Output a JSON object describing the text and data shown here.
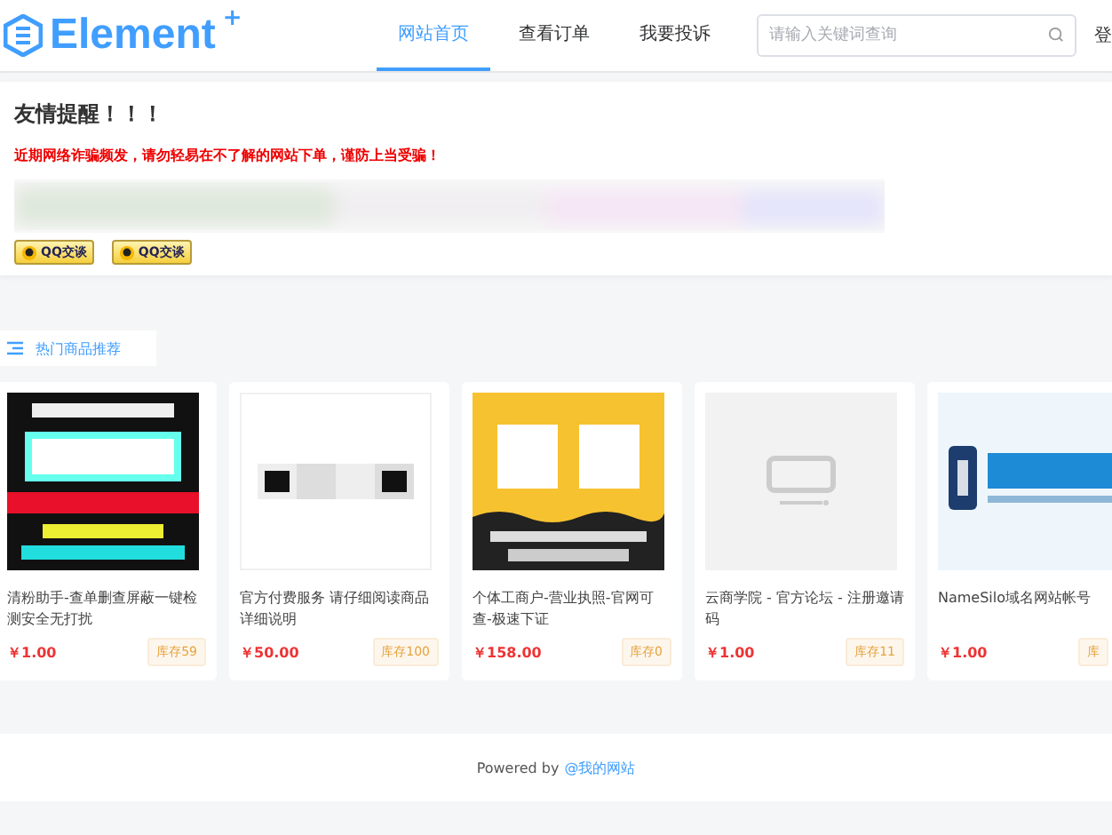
{
  "header": {
    "logo": "Element",
    "logo_mark": "+",
    "nav": [
      {
        "label": "网站首页",
        "selected": true
      },
      {
        "label": "查看订单",
        "selected": false
      },
      {
        "label": "我要投诉",
        "selected": false
      }
    ],
    "search": {
      "placeholder": "请输入关键词查询"
    },
    "login": "登"
  },
  "notice": {
    "title": "友情提醒！！！",
    "message": "近期网络诈骗频发，请勿轻易在不了解的网站下单，谨防上当受骗！",
    "qq_buttons": [
      "QQ交谈",
      "QQ交谈"
    ]
  },
  "section": {
    "title": "热门商品推荐"
  },
  "products": [
    {
      "kind": "picture",
      "title": "清粉助手-查单删查屏蔽一键检测安全无打扰",
      "price": "￥1.00",
      "stock": "库存59"
    },
    {
      "kind": "picture",
      "title": "官方付费服务 请仔细阅读商品详细说明",
      "price": "￥50.00",
      "stock": "库存100"
    },
    {
      "kind": "picture",
      "title": "个体工商户-营业执照-官网可查-极速下证",
      "price": "￥158.00",
      "stock": "库存0"
    },
    {
      "kind": "placeholder",
      "title": "云商学院 - 官方论坛 - 注册邀请码",
      "price": "￥1.00",
      "stock": "库存11"
    },
    {
      "kind": "picture",
      "title": "NameSilo域名网站帐号",
      "price": "￥1.00",
      "stock": "库"
    }
  ],
  "footer": {
    "text": "Powered by",
    "link": "@我的网站"
  }
}
